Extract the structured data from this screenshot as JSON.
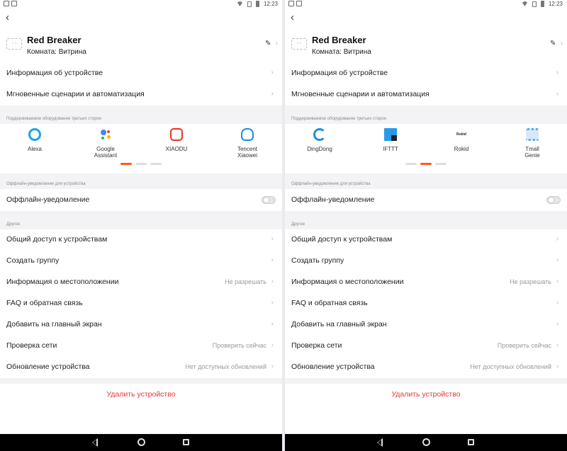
{
  "status": {
    "time": "12:23"
  },
  "device": {
    "name": "Red Breaker",
    "room": "Комната: Витрина"
  },
  "menu": {
    "info": "Информация об устройстве",
    "scenes": "Мгновенные сценарии и автоматизация"
  },
  "third_party": {
    "caption": "Поддерживаемое оборудование третьих сторон",
    "page1": [
      {
        "label": "Alexa",
        "icon": "alexa-icon",
        "color": "#1aa3e8"
      },
      {
        "label": "Google\nAssistant",
        "icon": "google-assistant-icon",
        "color": "#4285f4"
      },
      {
        "label": "XIAODU",
        "icon": "xiaodu-icon",
        "color": "#e8332a"
      },
      {
        "label": "Tencent\nXiaowei",
        "icon": "tencent-xiaowei-icon",
        "color": "#1e8ce8"
      }
    ],
    "page2": [
      {
        "label": "DingDong",
        "icon": "dingdong-icon",
        "color": "#1f8fd6"
      },
      {
        "label": "IFTTT",
        "icon": "ifttt-icon",
        "color": "#2a9ae8"
      },
      {
        "label": "Rokid",
        "icon": "rokid-icon",
        "color": "#222222"
      },
      {
        "label": "Tmall\nGenie",
        "icon": "tmall-genie-icon",
        "color": "#5aa8f0"
      }
    ],
    "active_page_left": 0,
    "active_page_right": 1
  },
  "offline": {
    "caption": "Оффлайн-уведомление для устройства",
    "label": "Оффлайн-уведомление",
    "enabled": false
  },
  "other": {
    "caption": "Другое",
    "items": [
      {
        "label": "Общий доступ к устройствам",
        "value": ""
      },
      {
        "label": "Создать группу",
        "value": ""
      },
      {
        "label": "Информация о местоположении",
        "value": "Не разрешать"
      },
      {
        "label": "FAQ и обратная связь",
        "value": ""
      },
      {
        "label": "Добавить на главный экран",
        "value": ""
      },
      {
        "label": "Проверка сети",
        "value": "Проверить сейчас"
      },
      {
        "label": "Обновление устройства",
        "value": "Нет доступных обновлений"
      }
    ]
  },
  "delete_label": "Удалить устройство",
  "colors": {
    "accent": "#ff5a1f",
    "danger": "#e53935"
  }
}
